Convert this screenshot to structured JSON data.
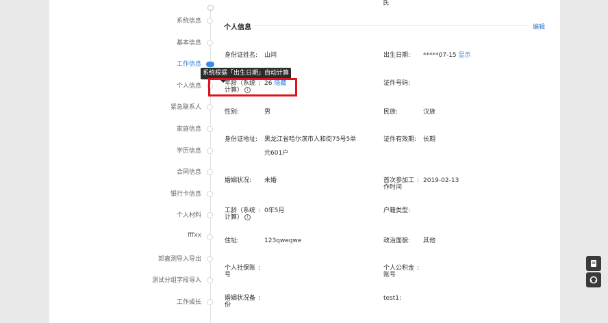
{
  "top_fragment": "氏",
  "nav": {
    "items": [
      {
        "label": "系统信息"
      },
      {
        "label": "基本信息"
      },
      {
        "label": "工作信息"
      },
      {
        "label": "个人信息"
      },
      {
        "label": "紧急联系人"
      },
      {
        "label": "家庭信息"
      },
      {
        "label": "学历信息"
      },
      {
        "label": "合同信息"
      },
      {
        "label": "银行卡信息"
      },
      {
        "label": "个人材料"
      },
      {
        "label": "fffxx"
      },
      {
        "label": "郭嘉测导入导出"
      },
      {
        "label": "测试分组字段导入"
      },
      {
        "label": "工作成长"
      }
    ],
    "active": "工作信息"
  },
  "section": {
    "title": "个人信息",
    "edit_label": "编辑"
  },
  "tooltip": {
    "text": "系统根据「出生日期」自动计算"
  },
  "fields": {
    "id_name": {
      "label": "身份证姓名:",
      "value": "山间"
    },
    "birth_date": {
      "label": "出生日期:",
      "value": "*****07-15",
      "action": "显示"
    },
    "age": {
      "label_line1": "年龄（系统",
      "label_line2": "计算）",
      "colon": ":",
      "value": "26",
      "action": "隐藏"
    },
    "id_number": {
      "label": "证件号码:"
    },
    "gender": {
      "label": "性别:",
      "value": "男"
    },
    "ethnicity": {
      "label": "民族:",
      "value": "汉族"
    },
    "id_address": {
      "label": "身份证地址:",
      "value_line1": "黑龙江省哈尔滨市人和街75号5单",
      "value_line2": "元601户"
    },
    "id_valid": {
      "label": "证件有效期:",
      "value": "长期"
    },
    "marital": {
      "label": "婚姻状况:",
      "value": "未婚"
    },
    "first_work": {
      "label_line1": "首次参加工",
      "label_line2": "作时间",
      "colon": ":",
      "value": "2019-02-13"
    },
    "work_years": {
      "label_line1": "工龄（系统",
      "label_line2": "计算）",
      "colon": ":",
      "value": "0年5月"
    },
    "hukou": {
      "label": "户籍类型:"
    },
    "address": {
      "label": "住址:",
      "value": "123qweqwe"
    },
    "political": {
      "label": "政治面貌:",
      "value": "其他"
    },
    "social_security": {
      "label_line1": "个人社保账",
      "label_line2": "号",
      "colon": ":"
    },
    "housing_fund": {
      "label_line1": "个人公积金",
      "label_line2": "账号",
      "colon": ":"
    },
    "marital_note": {
      "label_line1": "婚姻状况备",
      "label_line2": "份",
      "colon": ":"
    },
    "test1": {
      "label": "test1:"
    }
  },
  "colors": {
    "accent": "#2f7bd8",
    "highlight_border": "#e0121b",
    "tooltip_bg": "#2b2b2b"
  },
  "icons": [
    "info-icon",
    "document-icon",
    "headset-icon"
  ]
}
